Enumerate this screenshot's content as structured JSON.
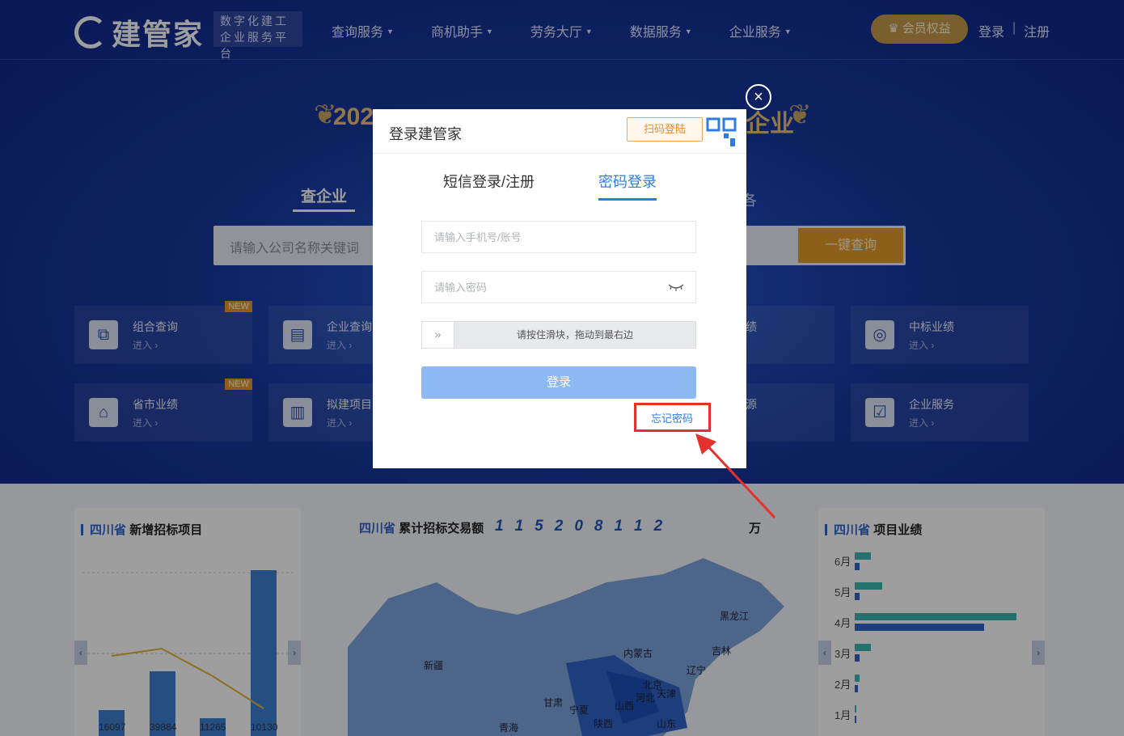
{
  "brand": {
    "name": "建管家",
    "slogan_line1": "数字化建工",
    "slogan_line2": "企业服务平台"
  },
  "nav": {
    "items": [
      "查询服务",
      "商机助手",
      "劳务大厅",
      "数据服务",
      "企业服务"
    ],
    "vip_label": "会员权益",
    "login": "登录",
    "separator": "|",
    "register": "注册"
  },
  "banner": {
    "title_left": "202",
    "title_right": "企业"
  },
  "search": {
    "tab_active": "查企业",
    "tab_right_fragment": "各",
    "placeholder": "请输入公司名称关键词",
    "button": "一键查询"
  },
  "cards": [
    {
      "title": "组合查询",
      "sub": "进入 ›",
      "badge": "NEW",
      "icon": "layers-icon"
    },
    {
      "title": "企业查询",
      "sub": "进入 ›",
      "icon": "building-icon"
    },
    {
      "title": "绩",
      "sub": "",
      "icon": ""
    },
    {
      "title": "中标业绩",
      "sub": "进入 ›",
      "icon": "target-icon"
    },
    {
      "title": "省市业绩",
      "sub": "进入 ›",
      "badge": "NEW",
      "icon": "home-icon"
    },
    {
      "title": "拟建项目",
      "sub": "进入 ›",
      "icon": "document-icon"
    },
    {
      "title": "源",
      "sub": "",
      "icon": ""
    },
    {
      "title": "企业服务",
      "sub": "进入 ›",
      "icon": "checkbox-icon"
    }
  ],
  "panels": {
    "left": {
      "province": "四川省",
      "title": "新增招标项目",
      "labels": [
        "16097",
        "39884",
        "11265",
        "10130"
      ]
    },
    "middle": {
      "province": "四川省",
      "title": "累计招标交易额",
      "digits": [
        "1",
        "1",
        "5",
        "2",
        "0",
        "8",
        "1",
        "1",
        "2"
      ],
      "unit": "万"
    },
    "right": {
      "province": "四川省",
      "title": "项目业绩",
      "months": [
        "6月",
        "5月",
        "4月",
        "3月",
        "2月",
        "1月"
      ]
    },
    "map_labels": [
      "黑龙江",
      "吉林",
      "内蒙古",
      "辽宁",
      "新疆",
      "北京",
      "河北",
      "天津",
      "山西",
      "甘肃",
      "宁夏",
      "青海",
      "陕西",
      "山东"
    ]
  },
  "modal": {
    "title": "登录建管家",
    "qr_tip": "扫码登陆",
    "tabs": {
      "sms": "短信登录/注册",
      "password": "密码登录"
    },
    "account_placeholder": "请输入手机号/账号",
    "password_placeholder": "请输入密码",
    "slider_text": "请按住滑块，拖动到最右边",
    "slider_handle": "»",
    "login_button": "登录",
    "forgot": "忘记密码",
    "close": "×"
  },
  "colors": {
    "accent": "#2f7be5",
    "annotation": "#e5312e",
    "hero": "#17389f",
    "gold": "#e39c2b"
  }
}
